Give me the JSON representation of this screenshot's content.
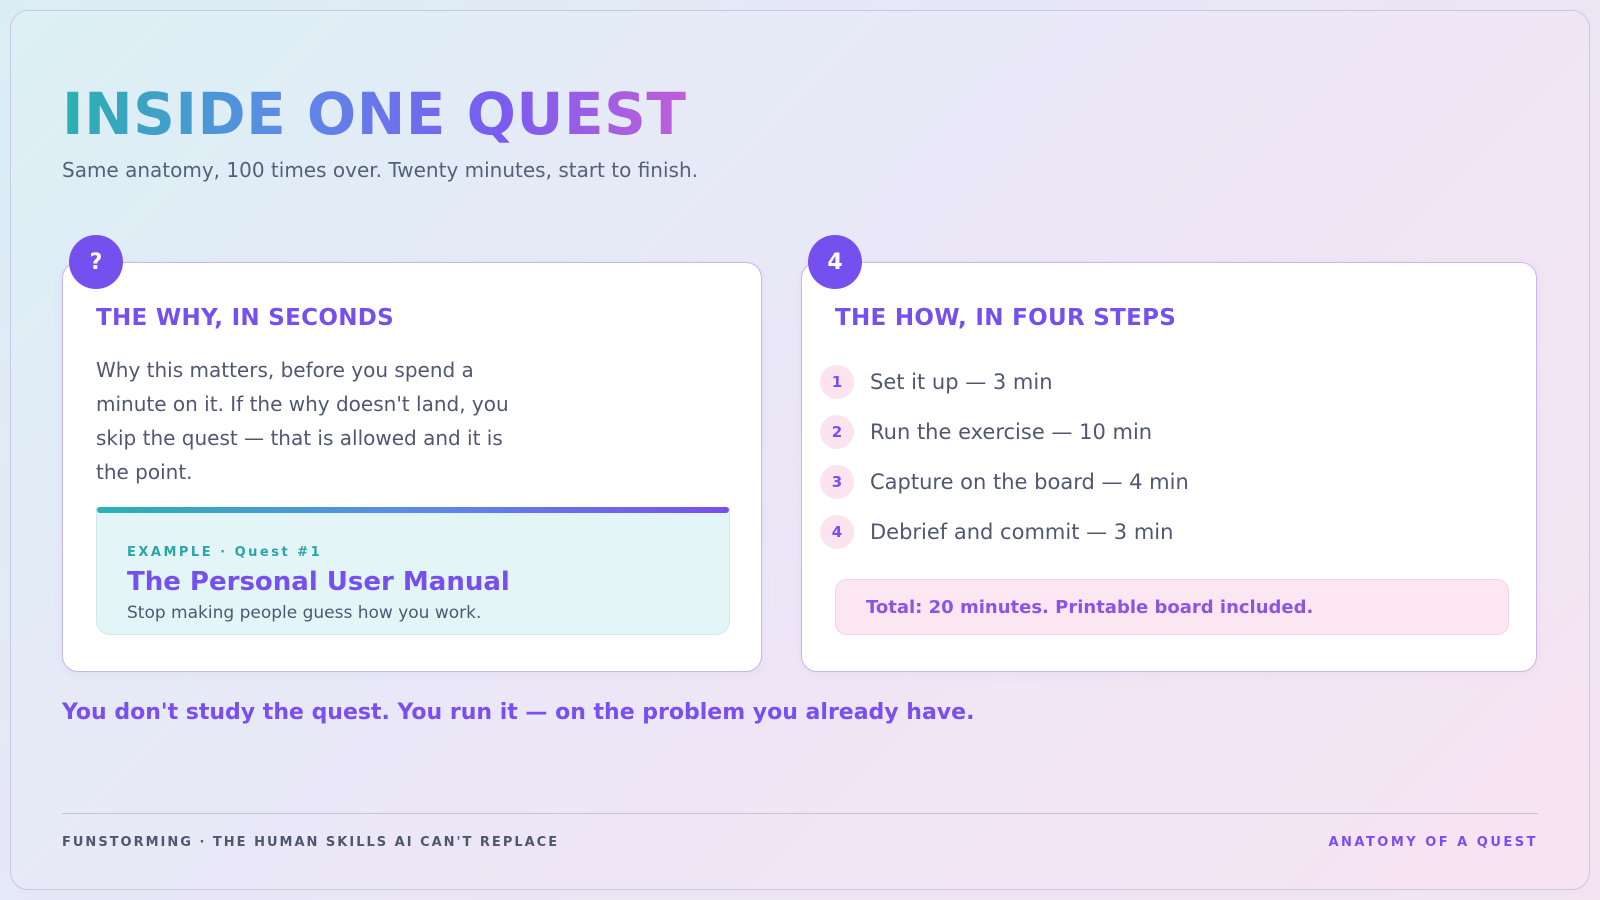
{
  "header": {
    "title": "INSIDE ONE QUEST",
    "subtitle": "Same anatomy, 100 times over. Twenty minutes, start to finish."
  },
  "why_card": {
    "badge": "?",
    "heading": "THE WHY, IN SECONDS",
    "body": "Why this matters, before you spend a minute on it. If the why doesn't land, you skip the quest — that is allowed and it is the point.",
    "example": {
      "label": "EXAMPLE · Quest #1",
      "title": "The Personal User Manual",
      "subtitle": "Stop making people guess how you work."
    }
  },
  "how_card": {
    "badge": "4",
    "heading": "THE HOW, IN FOUR STEPS",
    "steps": [
      {
        "num": "1",
        "text": "Set it up — 3 min"
      },
      {
        "num": "2",
        "text": "Run the exercise — 10 min"
      },
      {
        "num": "3",
        "text": "Capture on the board — 4 min"
      },
      {
        "num": "4",
        "text": "Debrief and commit — 3 min"
      }
    ],
    "total": "Total: 20 minutes. Printable board included."
  },
  "tagline": "You don't study the quest. You run it — on the problem you already have.",
  "footer": {
    "left": "FUNSTORMING · THE HUMAN SKILLS AI CAN'T REPLACE",
    "right": "ANATOMY OF A QUEST"
  },
  "colors": {
    "accent": "#7550ef",
    "teal": "#2ab1b0",
    "pink_bg": "#fce6f1"
  }
}
